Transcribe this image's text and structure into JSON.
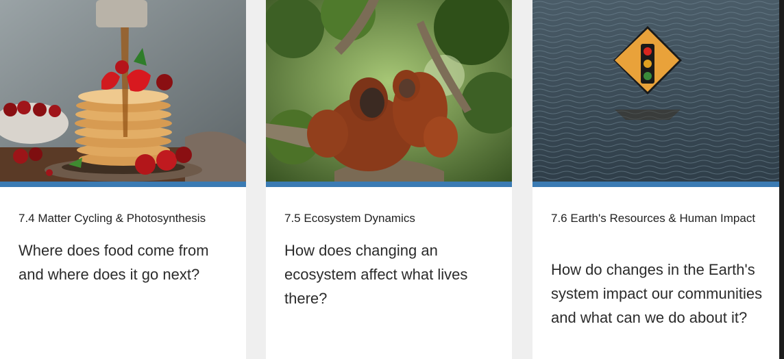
{
  "cards": [
    {
      "label": "7.4 Matter Cycling & Photosynthesis",
      "question": "Where does food come from and where does it go next?",
      "image_icon": "pancakes-with-cherries-image"
    },
    {
      "label": "7.5 Ecosystem Dynamics",
      "question": "How does changing an ecosystem affect what lives there?",
      "image_icon": "orangutans-in-tree-image"
    },
    {
      "label": "7.6 Earth's Resources & Human Impact",
      "question": "How do changes in the Earth's system impact our communities and what can we do about it?",
      "image_icon": "flooded-traffic-sign-image"
    }
  ],
  "colors": {
    "accent_bar": "#3b7bb3",
    "card_bg": "#ffffff",
    "page_bg": "#efefef"
  }
}
